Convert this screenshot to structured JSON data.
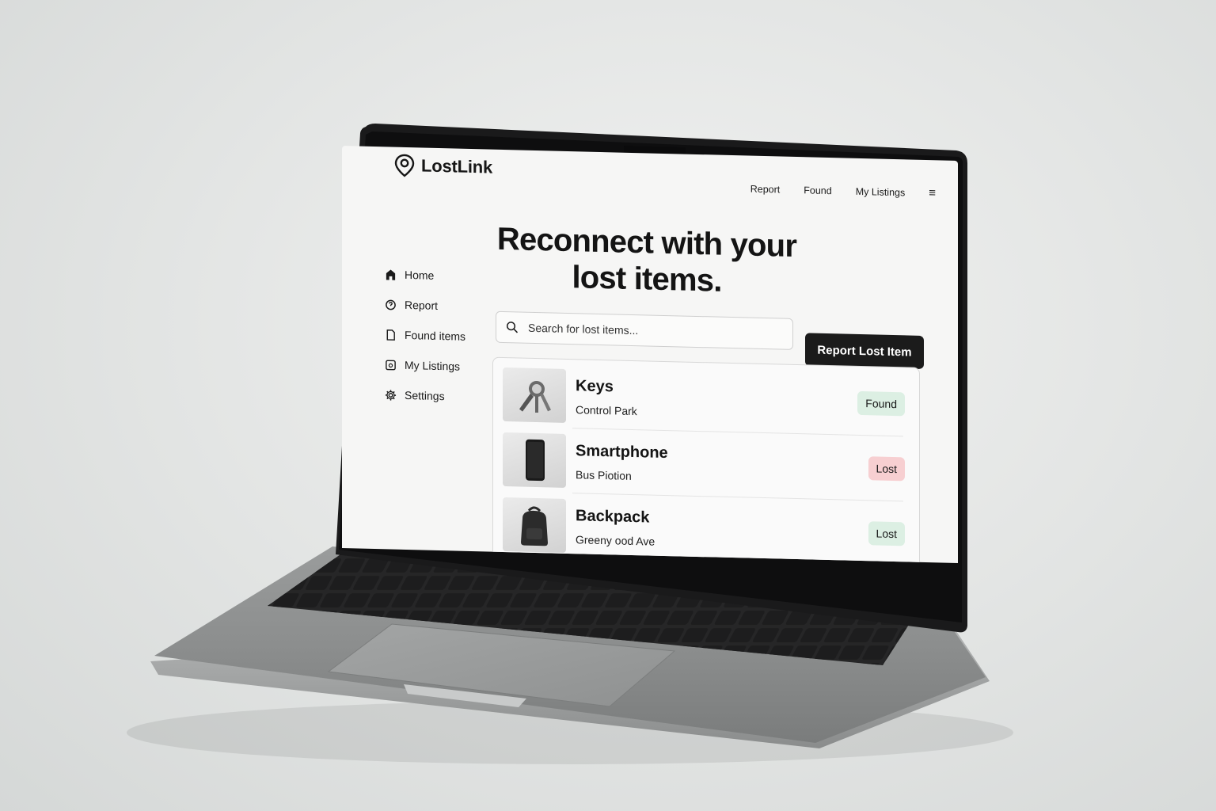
{
  "app": {
    "name": "LostLink"
  },
  "topnav": {
    "items": [
      "Report",
      "Found",
      "My Listings"
    ],
    "menu_icon": "hamburger-menu-icon"
  },
  "sidebar": {
    "items": [
      {
        "label": "Home",
        "icon": "home-icon"
      },
      {
        "label": "Report",
        "icon": "report-icon"
      },
      {
        "label": "Found items",
        "icon": "document-icon"
      },
      {
        "label": "My Listings",
        "icon": "listings-icon"
      },
      {
        "label": "Settings",
        "icon": "gear-icon"
      }
    ]
  },
  "hero": {
    "line1": "Reconnect with your",
    "line2": "lost items."
  },
  "search": {
    "placeholder": "Search for lost items..."
  },
  "actions": {
    "report_label": "Report Lost Item"
  },
  "listings": [
    {
      "title": "Keys",
      "location": "Control Park",
      "status": "Found",
      "status_color": "#dcefe3",
      "image": "keys-image"
    },
    {
      "title": "Smartphone",
      "location": "Bus Piotion",
      "status": "Lost",
      "status_color": "#f7cfd1",
      "image": "smartphone-image"
    },
    {
      "title": "Backpack",
      "location": "Greeny ood Ave",
      "status": "Lost",
      "status_color": "#dcefe3",
      "image": "backpack-image"
    }
  ],
  "colors": {
    "primary_button": "#1b1b1b",
    "found_badge": "#dcefe3",
    "lost_badge": "#f7cfd1",
    "screen_background": "#f6f6f5"
  }
}
